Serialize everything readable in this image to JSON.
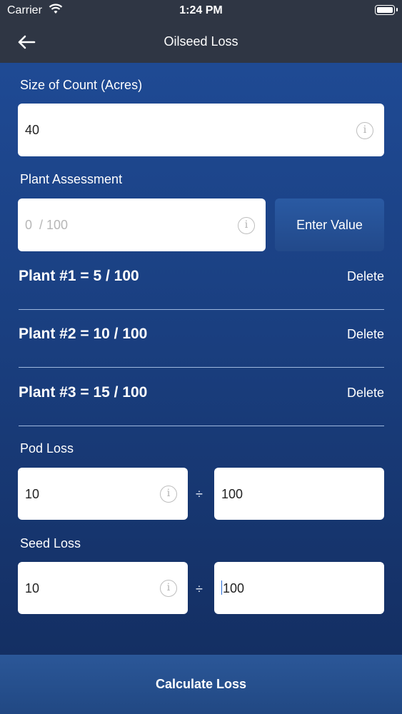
{
  "status": {
    "carrier": "Carrier",
    "time": "1:24 PM"
  },
  "nav": {
    "title": "Oilseed Loss",
    "back_icon": "arrow-left"
  },
  "size_of_count": {
    "label": "Size of Count (Acres)",
    "value": "40",
    "info_icon": "info-circle"
  },
  "plant_assessment": {
    "label": "Plant Assessment",
    "placeholder": "0  / 100",
    "button_label": "Enter Value"
  },
  "plants": [
    {
      "text": "Plant #1 = 5 / 100",
      "delete_label": "Delete"
    },
    {
      "text": "Plant #2 = 10 / 100",
      "delete_label": "Delete"
    },
    {
      "text": "Plant #3 = 15 / 100",
      "delete_label": "Delete"
    }
  ],
  "pod_loss": {
    "label": "Pod Loss",
    "numerator": "10",
    "denominator": "100",
    "divide_symbol": "÷"
  },
  "seed_loss": {
    "label": "Seed Loss",
    "numerator": "10",
    "denominator": "100",
    "divide_symbol": "÷"
  },
  "calculate_button": "Calculate Loss",
  "colors": {
    "header": "#2f3644",
    "background": "#1a3f80",
    "button": "#2b5798"
  }
}
